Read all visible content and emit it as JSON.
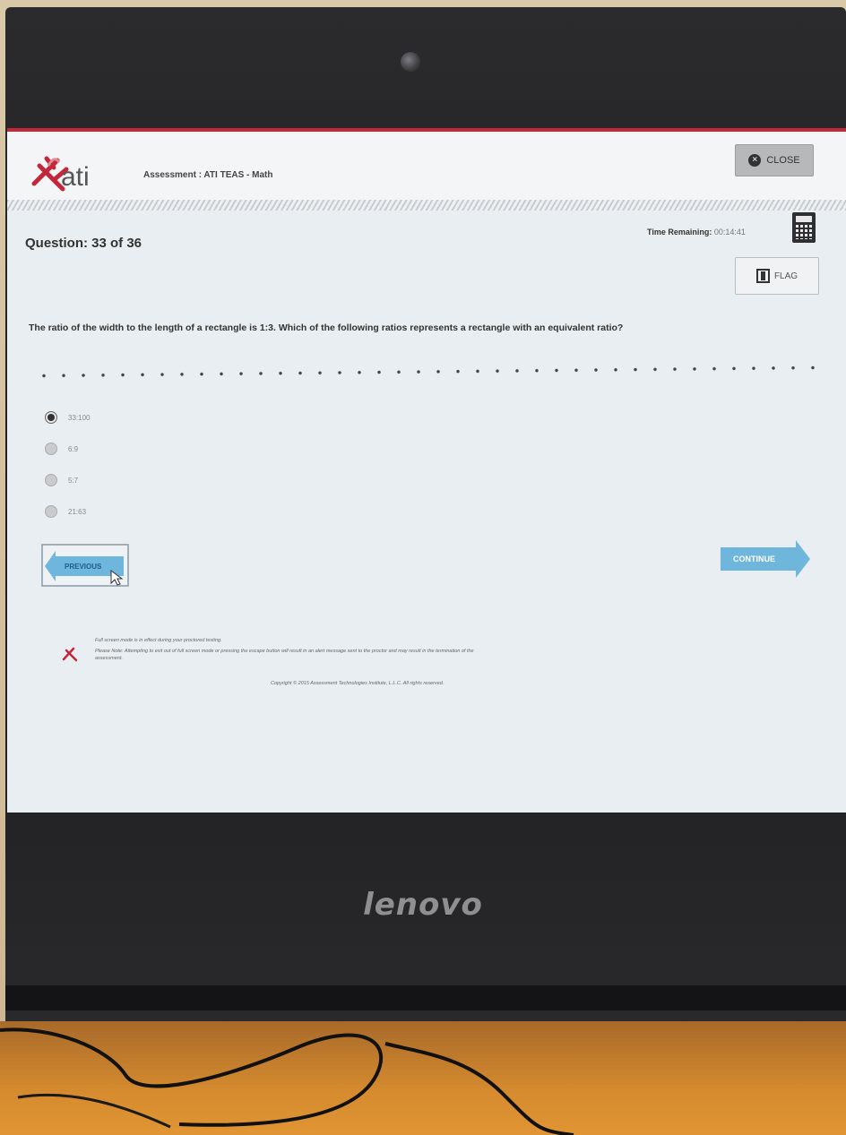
{
  "header": {
    "logo_text": "ati",
    "assessment_label": "Assessment : ATI TEAS - Math",
    "close_label": "CLOSE"
  },
  "status": {
    "question_counter": "Question: 33 of 36",
    "time_remaining_label": "Time Remaining:",
    "time_remaining_value": "00:14:41",
    "flag_label": "FLAG"
  },
  "question": {
    "text": "The ratio of the width to the length of a rectangle is 1:3. Which of the following ratios represents a rectangle with an equivalent ratio?",
    "options": [
      {
        "label": "33:100",
        "selected": true
      },
      {
        "label": "6:9",
        "selected": false
      },
      {
        "label": "5:7",
        "selected": false
      },
      {
        "label": "21:63",
        "selected": false
      }
    ]
  },
  "navigation": {
    "previous_label": "PREVIOUS",
    "continue_label": "CONTINUE"
  },
  "footer": {
    "line1": "Full screen mode is in effect during your proctored testing.",
    "line2": "Please Note: Attempting to exit out of full screen mode or pressing the escape button will result in an alert message sent to the proctor and may result in the termination of the",
    "line3": "assessment.",
    "copyright": "Copyright © 2015 Assessment Technologies Institute, L.L.C. All rights reserved."
  },
  "device": {
    "brand": "lenovo"
  },
  "colors": {
    "accent_red": "#c2273a",
    "nav_button_blue": "#6fb6dc",
    "screen_background": "#e9eef2"
  }
}
